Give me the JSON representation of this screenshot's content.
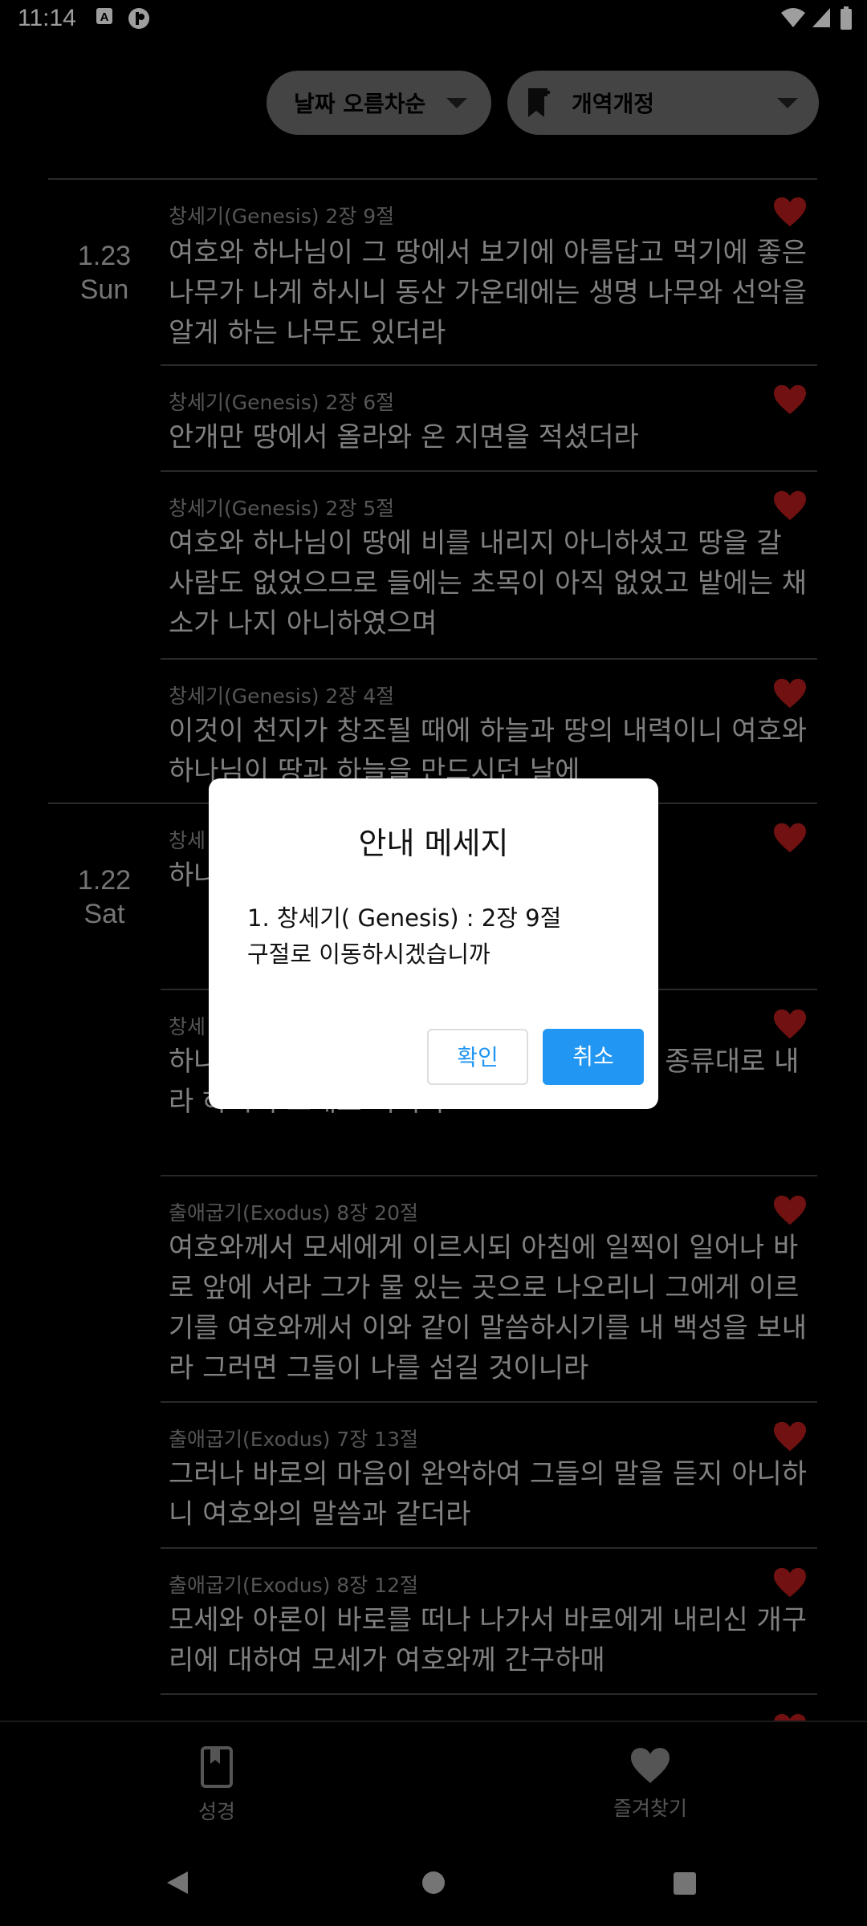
{
  "status_bar": {
    "time": "11:14"
  },
  "filters": {
    "sort_label": "날짜 오름차순",
    "version_label": "개역개정"
  },
  "groups": [
    {
      "date": "1.23",
      "day": "Sun",
      "entries": [
        {
          "ref": "창세기(Genesis) 2장 9절",
          "text": "여호와 하나님이 그 땅에서 보기에 아름답고 먹기에 좋은 나무가 나게 하시니 동산 가운데에는 생명 나무와 선악을 알게 하는 나무도 있더라"
        },
        {
          "ref": "창세기(Genesis) 2장 6절",
          "text": "안개만 땅에서 올라와 온 지면을 적셨더라"
        },
        {
          "ref": "창세기(Genesis) 2장 5절",
          "text": "여호와 하나님이 땅에 비를 내리지 아니하셨고 땅을 갈 사람도 없었으므로 들에는 초목이 아직 없었고 밭에는 채소가 나지 아니하였으며"
        },
        {
          "ref": "창세기(Genesis) 2장 4절",
          "text": "이것이 천지가 창조될 때에 하늘과 땅의 내력이니 여호와 하나님이 땅과 하늘을 만드시던 날에"
        }
      ]
    },
    {
      "date": "1.22",
      "day": "Sat",
      "entries": [
        {
          "ref": "창세",
          "text": "하나                                                                  생육하고 번성                                                                  땅에 번성"
        },
        {
          "ref": "창세",
          "text": "하나                                                                  로 내되 가축과 기는 것과 땅의 짐승을 종류대로 내라 하시니 그대로 되니라"
        },
        {
          "ref": "출애굽기(Exodus) 8장 20절",
          "text": "여호와께서 모세에게 이르시되 아침에 일찍이 일어나 바로 앞에 서라 그가 물 있는 곳으로 나오리니 그에게 이르기를 여호와께서 이와 같이 말씀하시기를 내 백성을 보내라 그러면 그들이 나를 섬길 것이니라"
        },
        {
          "ref": "출애굽기(Exodus) 7장 13절",
          "text": "그러나 바로의 마음이 완악하여 그들의 말을 듣지 아니하니 여호와의 말씀과 같더라"
        },
        {
          "ref": "출애굽기(Exodus) 8장 12절",
          "text": "모세와 아론이 바로를 떠나 나가서 바로에게 내리신 개구리에 대하여 모세가 여호와께 간구하매"
        }
      ]
    }
  ],
  "dialog": {
    "title": "안내 메세지",
    "message_line1": "1. 창세기(  Genesis) :  2장  9절",
    "message_line2": "구절로 이동하시겠습니까",
    "ok_label": "확인",
    "cancel_label": "취소"
  },
  "bottom_nav": {
    "bible_label": "성경",
    "favorites_label": "즐겨찾기"
  },
  "colors": {
    "heart": "#b71c1c",
    "accent": "#2196f3",
    "chip": "#6f6f6f"
  }
}
